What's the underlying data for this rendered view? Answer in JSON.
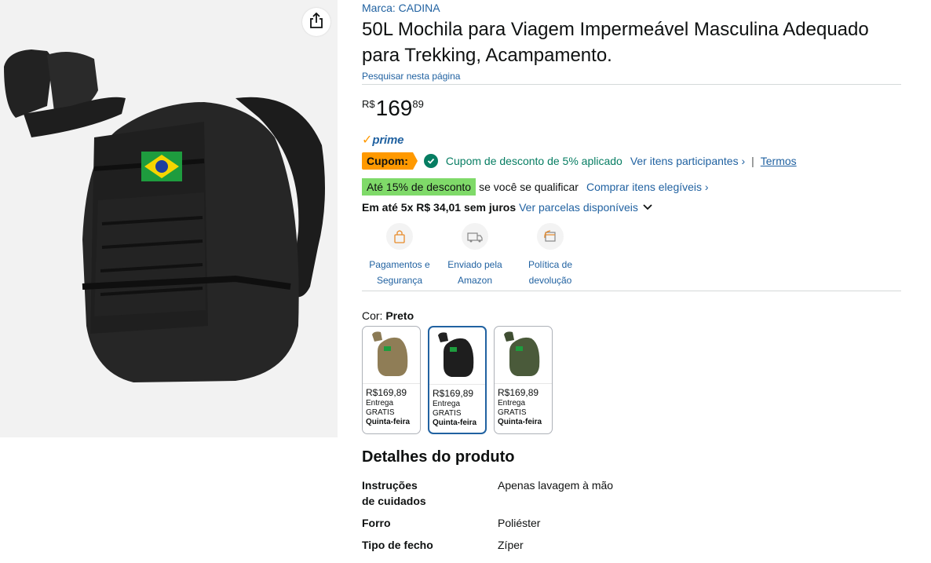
{
  "gallery": {
    "share_icon": "share-icon",
    "product_image_alt": "black-tactical-backpack"
  },
  "product": {
    "brand": "Marca: CADINA",
    "title": "50L Mochila para Viagem Impermeável Masculina Adequado para Trekking, Acampamento.",
    "search_page": "Pesquisar nesta página"
  },
  "price": {
    "symbol": "R$",
    "whole": "169",
    "fraction": "89"
  },
  "prime": {
    "check": "✓",
    "label": "prime"
  },
  "coupon": {
    "badge": "Cupom:",
    "text": "Cupom de desconto de 5% aplicado",
    "participants_link": "Ver itens participantes ›",
    "separator": "|",
    "terms_link": "Termos"
  },
  "discount": {
    "badge": "Até 15% de desconto",
    "text": "se você se qualificar",
    "link": "Comprar itens elegíveis ›"
  },
  "installments": {
    "text": "Em até 5x R$ 34,01 sem juros",
    "link": "Ver parcelas disponíveis"
  },
  "features": [
    {
      "icon": "lock-icon",
      "label1": "Pagamentos e",
      "label2": "Segurança"
    },
    {
      "icon": "truck-icon",
      "label1": "Enviado pela",
      "label2": "Amazon"
    },
    {
      "icon": "return-icon",
      "label1": "Política de",
      "label2": "devolução"
    }
  ],
  "color": {
    "label": "Cor:",
    "selected": "Preto"
  },
  "swatches": [
    {
      "color": "#8b7a55",
      "price": "R$169,89",
      "delivery1": "Entrega",
      "delivery2": "GRATIS",
      "day": "Quinta-feira"
    },
    {
      "color": "#1a1a1a",
      "price": "R$169,89",
      "delivery1": "Entrega",
      "delivery2": "GRATIS",
      "day": "Quinta-feira"
    },
    {
      "color": "#4a5a3a",
      "price": "R$169,89",
      "delivery1": "Entrega",
      "delivery2": "GRATIS",
      "day": "Quinta-feira"
    }
  ],
  "details": {
    "title": "Detalhes do produto",
    "rows": [
      {
        "key": "Instruções de cuidados",
        "value": "Apenas lavagem à mão"
      },
      {
        "key": "Forro",
        "value": "Poliéster"
      },
      {
        "key": "Tipo de fecho",
        "value": "Zíper"
      }
    ]
  }
}
